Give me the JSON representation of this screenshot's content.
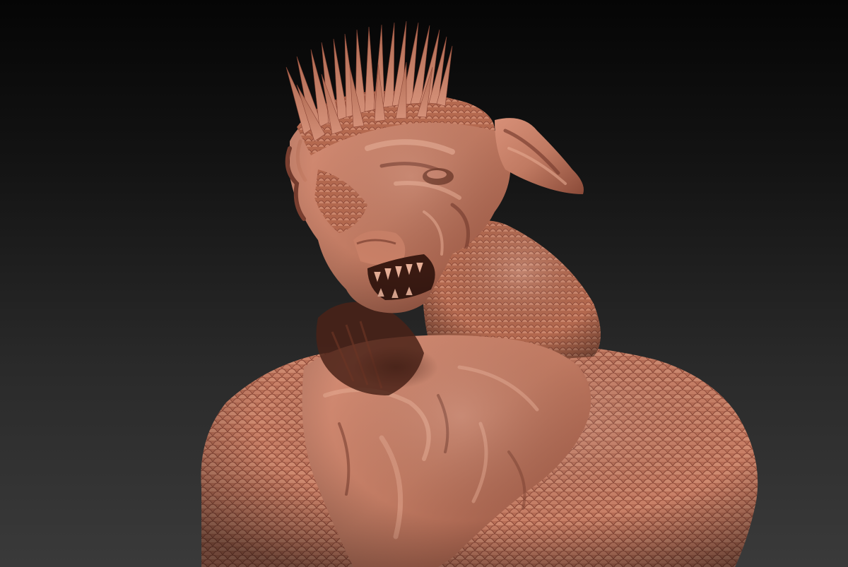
{
  "scene": {
    "subject": "sculpt-bust",
    "colors": {
      "background_top": "#050505",
      "background_bottom": "#3a3a3a",
      "clay_base": "#c07a62",
      "clay_light": "#e0a088",
      "clay_dark": "#7a3f30",
      "clay_shadow": "#4a2218"
    }
  }
}
